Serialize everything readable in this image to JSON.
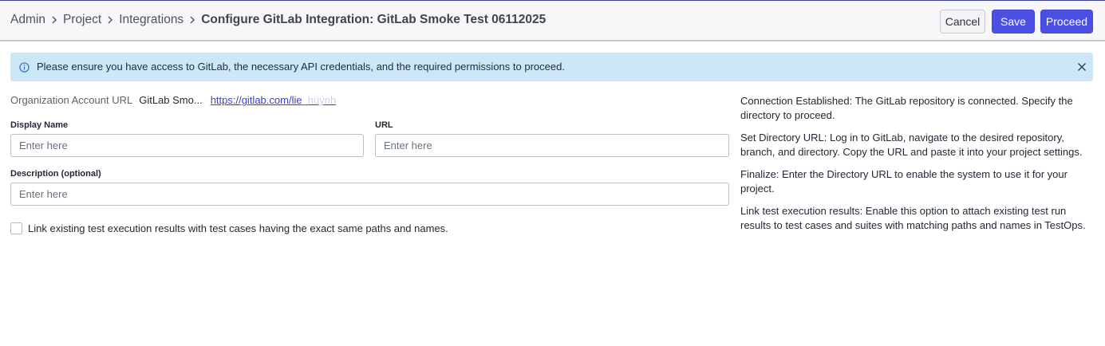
{
  "header": {
    "breadcrumb": [
      "Admin",
      "Project",
      "Integrations"
    ],
    "current": "Configure GitLab Integration: GitLab Smoke Test 06112025",
    "cancel_label": "Cancel",
    "save_label": "Save",
    "proceed_label": "Proceed"
  },
  "banner": {
    "message": "Please ensure you have access to GitLab, the necessary API credentials, and the required permissions to proceed."
  },
  "org": {
    "label": "Organization Account URL",
    "name": "GitLab Smo...",
    "url_visible": "https://gitlab.com/lie",
    "url_faded": "_huynh"
  },
  "form": {
    "display_name_label": "Display Name",
    "display_name_placeholder": "Enter here",
    "url_label": "URL",
    "url_placeholder": "Enter here",
    "description_label": "Description (optional)",
    "description_placeholder": "Enter here",
    "link_checkbox_label": "Link existing test execution results with test cases having the exact same paths and names.",
    "link_checkbox_checked": false
  },
  "help": [
    "Connection Established: The GitLab repository is connected. Specify the directory to proceed.",
    "Set Directory URL: Log in to GitLab, navigate to the desired repository, branch, and directory. Copy the URL and paste it into your project settings.",
    "Finalize: Enter the Directory URL to enable the system to use it for your project.",
    "Link test execution results: Enable this option to attach existing test run results to test cases and suites with matching paths and names in TestOps."
  ],
  "colors": {
    "primary": "#4b4fe4",
    "banner_bg": "#cce8f7",
    "link": "#3b3fd2"
  }
}
